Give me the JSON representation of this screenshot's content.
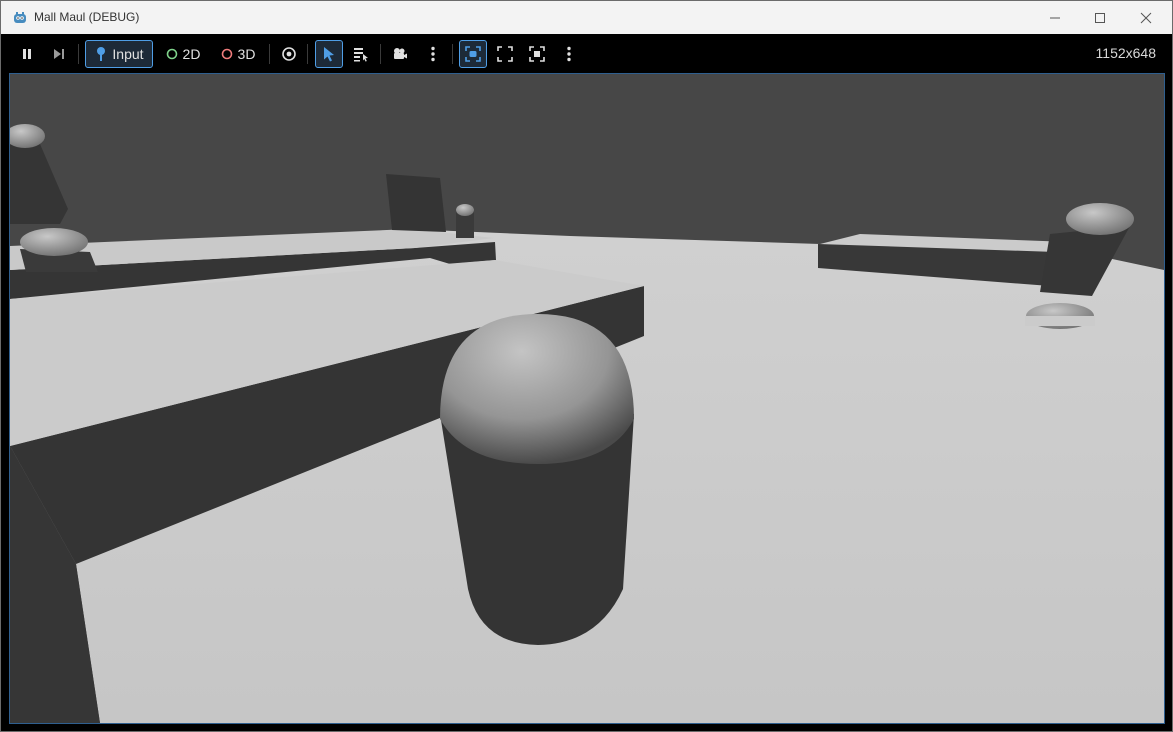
{
  "window": {
    "title": "Mall Maul (DEBUG)"
  },
  "toolbar": {
    "input_label": "Input",
    "mode_2d_label": "2D",
    "mode_3d_label": "3D",
    "resolution": "1152x648",
    "icons": [
      "pause-icon",
      "next-frame-icon",
      "input-icon",
      "eye-icon",
      "select-arrow-icon",
      "list-select-icon",
      "camera-icon",
      "more-vertical-icon",
      "focus-icon",
      "fullscreen-icon",
      "expand-icon",
      "more-vertical-icon"
    ]
  },
  "colors": {
    "accent": "#4f9ee6",
    "mode_2d": "#7fd38b",
    "mode_3d": "#f07c7c",
    "floor": "#cccccc",
    "wall": "#363636",
    "sky": "#474747"
  }
}
